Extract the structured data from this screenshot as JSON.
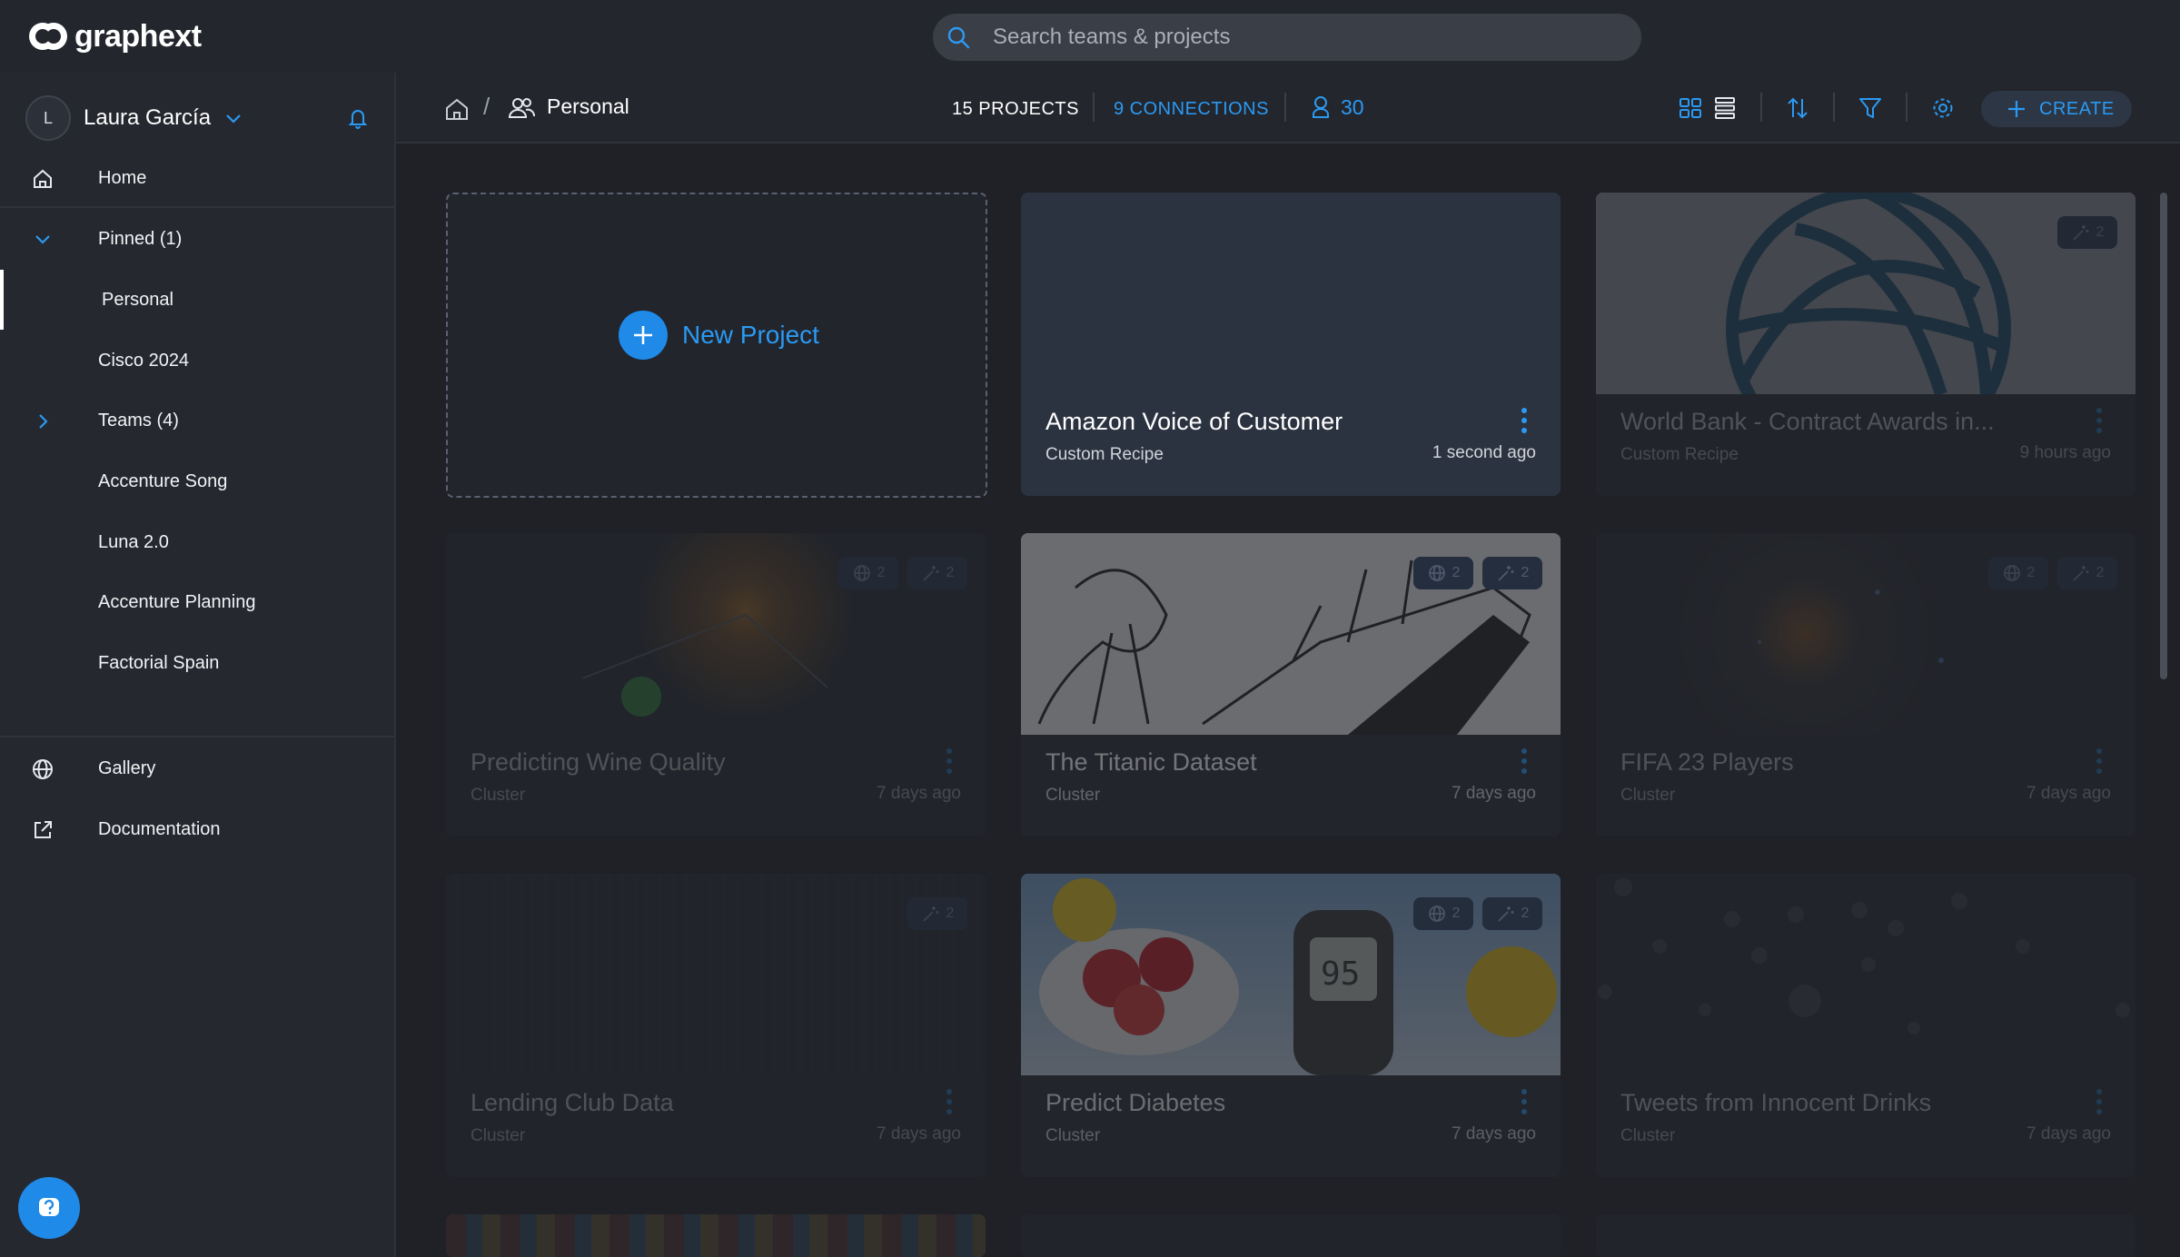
{
  "app": {
    "brand": "graphext"
  },
  "search": {
    "placeholder": "Search teams & projects"
  },
  "user": {
    "initial": "L",
    "name": "Laura García"
  },
  "sidebar": {
    "home": "Home",
    "pinned": "Pinned (1)",
    "pinned_items": [
      "Personal",
      "Cisco 2024"
    ],
    "teams": "Teams (4)",
    "team_items": [
      "Accenture Song",
      "Luna 2.0",
      "Accenture Planning",
      "Factorial Spain"
    ],
    "gallery": "Gallery",
    "documentation": "Documentation"
  },
  "header": {
    "breadcrumb_current": "Personal",
    "projects_count": "15 PROJECTS",
    "connections": "9 CONNECTIONS",
    "users_count": "30",
    "create_label": "CREATE"
  },
  "new_project": {
    "label": "New Project"
  },
  "cards": [
    {
      "title": "Amazon Voice of Customer",
      "type": "Custom Recipe",
      "time": "1 second ago",
      "badges": []
    },
    {
      "title": "World Bank - Contract Awards in...",
      "type": "Custom Recipe",
      "time": "9 hours ago",
      "badges": [
        {
          "icon": "wand-icon",
          "count": "2"
        }
      ]
    },
    {
      "title": "Predicting Wine Quality",
      "type": "Cluster",
      "time": "7 days ago",
      "badges": [
        {
          "icon": "globe-icon",
          "count": "2"
        },
        {
          "icon": "wand-icon",
          "count": "2"
        }
      ]
    },
    {
      "title": "The Titanic Dataset",
      "type": "Cluster",
      "time": "7 days ago",
      "badges": [
        {
          "icon": "globe-icon",
          "count": "2"
        },
        {
          "icon": "wand-icon",
          "count": "2"
        }
      ]
    },
    {
      "title": "FIFA 23 Players",
      "type": "Cluster",
      "time": "7 days ago",
      "badges": [
        {
          "icon": "globe-icon",
          "count": "2"
        },
        {
          "icon": "wand-icon",
          "count": "2"
        }
      ]
    },
    {
      "title": "Lending Club Data",
      "type": "Cluster",
      "time": "7 days ago",
      "badges": [
        {
          "icon": "wand-icon",
          "count": "2"
        }
      ]
    },
    {
      "title": "Predict Diabetes",
      "type": "Cluster",
      "time": "7 days ago",
      "badges": [
        {
          "icon": "globe-icon",
          "count": "2"
        },
        {
          "icon": "wand-icon",
          "count": "2"
        }
      ]
    },
    {
      "title": "Tweets from Innocent Drinks",
      "type": "Cluster",
      "time": "7 days ago",
      "badges": []
    }
  ],
  "colors": {
    "accent": "#2b9af3",
    "background": "#1f2126",
    "sidebar": "#25282f",
    "card": "#2a2e36"
  }
}
